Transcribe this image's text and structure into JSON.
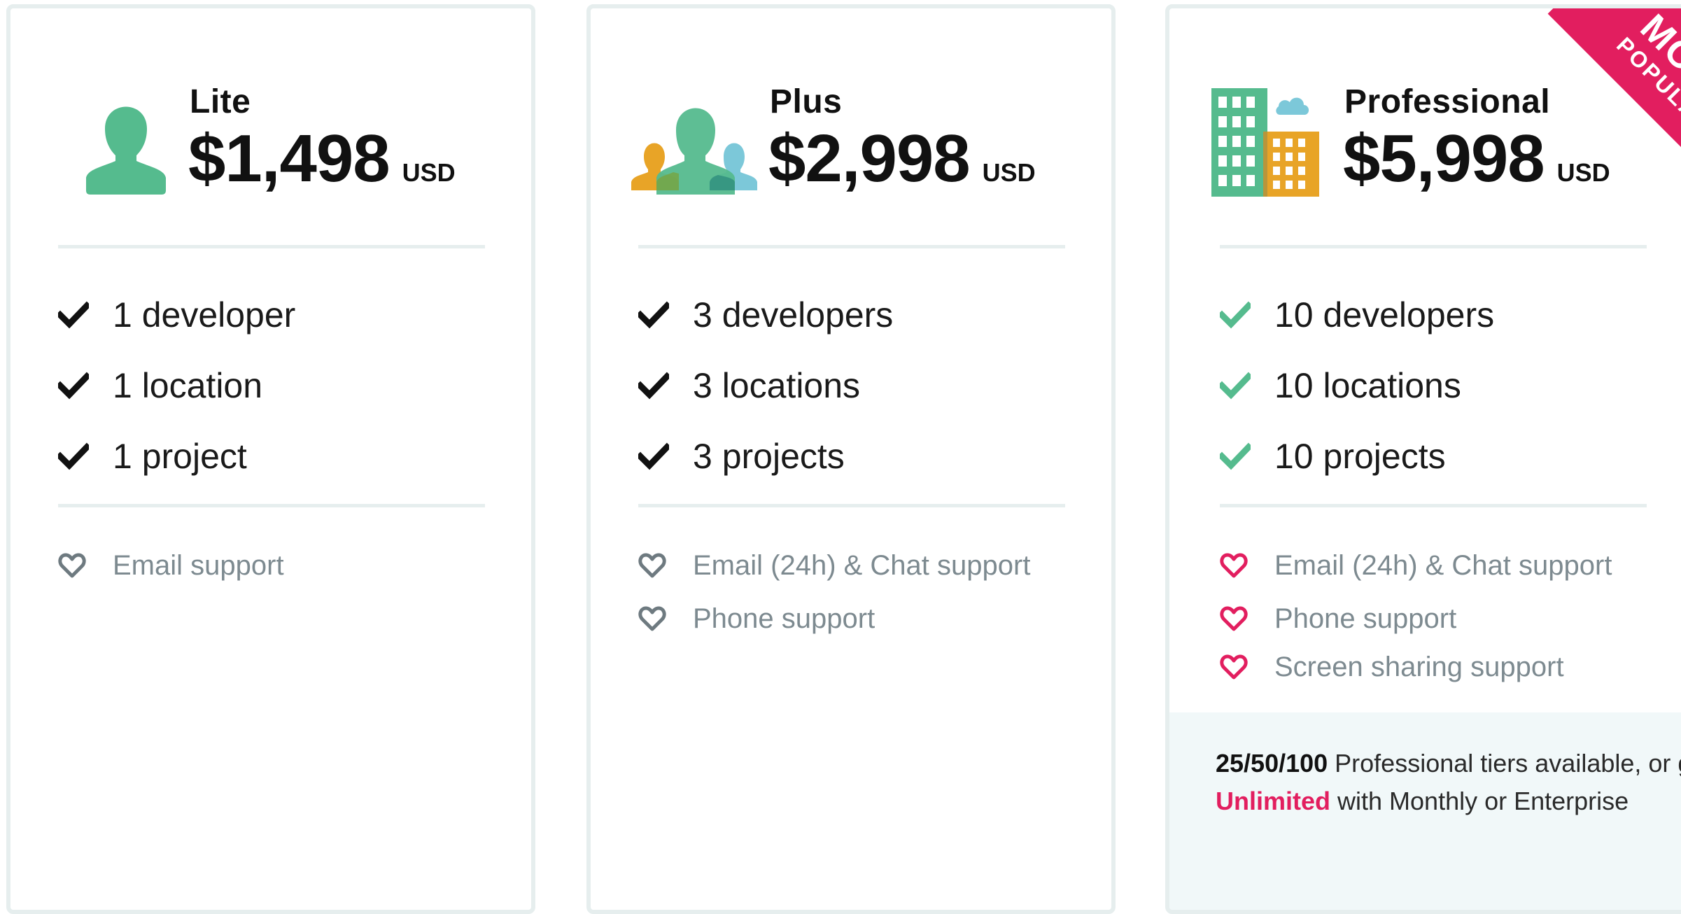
{
  "colors": {
    "green": "#55bb8e",
    "orange": "#e8a427",
    "blue": "#7cc8d9",
    "pink": "#e21e5f",
    "gray": "#7d8a90",
    "divider": "#e6eeee"
  },
  "plans": [
    {
      "name": "Lite",
      "price": "$1,498",
      "currency": "USD",
      "icon": "single-user-icon",
      "features": [
        "1 developer",
        "1 location",
        "1 project"
      ],
      "support": [
        "Email support"
      ]
    },
    {
      "name": "Plus",
      "price": "$2,998",
      "currency": "USD",
      "icon": "team-users-icon",
      "features": [
        "3 developers",
        "3 locations",
        "3 projects"
      ],
      "support": [
        "Email (24h) & Chat support",
        "Phone support"
      ]
    },
    {
      "name": "Professional",
      "price": "$5,998",
      "currency": "USD",
      "icon": "buildings-cloud-icon",
      "badge": {
        "line1": "MOST",
        "line2": "POPULAR"
      },
      "features": [
        "10 developers",
        "10 locations",
        "10 projects"
      ],
      "support": [
        "Email (24h) & Chat support",
        "Phone support",
        "Screen sharing support"
      ],
      "tiers_note": {
        "tiers": "25/50/100",
        "text1": " Professional tiers available, or go ",
        "unlimited": "Unlimited",
        "text2": " with Monthly or Enterprise"
      }
    }
  ]
}
